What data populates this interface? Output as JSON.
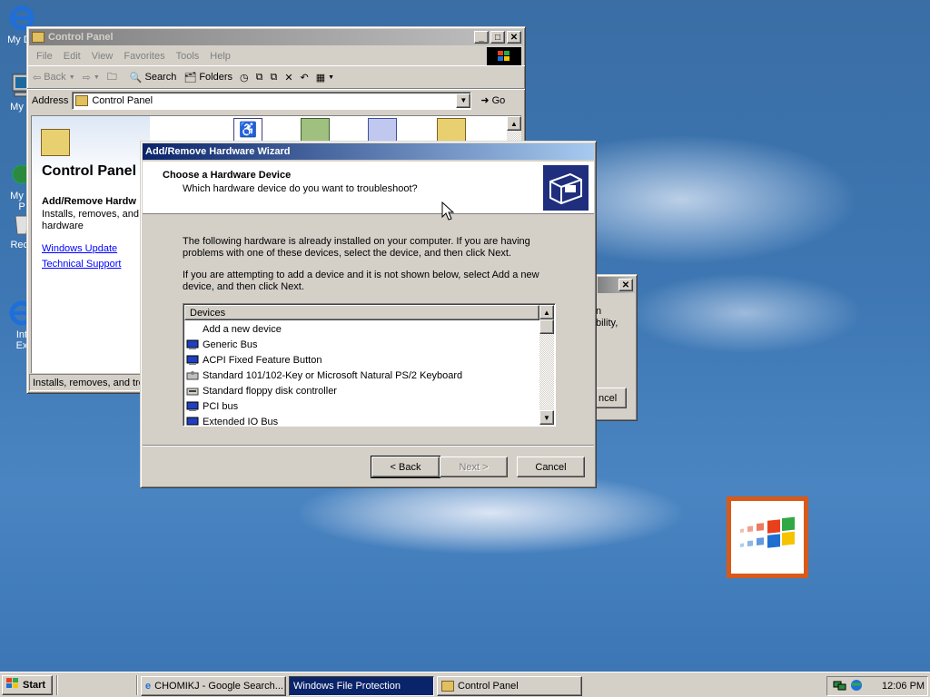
{
  "desktop": {
    "icons": [
      {
        "label": "My Do"
      },
      {
        "label": "My C"
      },
      {
        "label": "My N\nP"
      },
      {
        "label": "Recy"
      },
      {
        "label": "Int\nEx"
      }
    ]
  },
  "control_panel": {
    "title": "Control Panel",
    "menu": [
      "File",
      "Edit",
      "View",
      "Favorites",
      "Tools",
      "Help"
    ],
    "toolbar": {
      "back": "Back",
      "search": "Search",
      "folders": "Folders"
    },
    "address_label": "Address",
    "address_value": "Control Panel",
    "go_label": "Go",
    "panel_title": "Control Panel",
    "selected_title": "Add/Remove Hardw",
    "selected_desc": "Installs, removes, and hardware",
    "links": [
      "Windows Update",
      "Technical Support"
    ],
    "status_text": "Installs, removes, and tro"
  },
  "background_dialog": {
    "text_lines": [
      "n",
      "bility,"
    ],
    "button": "ncel"
  },
  "wizard": {
    "title": "Add/Remove Hardware Wizard",
    "heading": "Choose a Hardware Device",
    "subheading": "Which hardware device do you want to troubleshoot?",
    "para1": "The following hardware is already installed on your computer. If you are having problems with one of these devices, select the device, and then click Next.",
    "para2": "If you are attempting to add a device and it is not shown below, select Add a new device, and then click Next.",
    "list_header": "Devices",
    "devices": [
      {
        "name": "Add a new device",
        "icon": "none"
      },
      {
        "name": "Generic Bus",
        "icon": "computer-icon"
      },
      {
        "name": "ACPI Fixed Feature Button",
        "icon": "computer-icon"
      },
      {
        "name": "Standard 101/102-Key or Microsoft Natural PS/2 Keyboard",
        "icon": "keyboard-icon"
      },
      {
        "name": "Standard floppy disk controller",
        "icon": "floppy-controller-icon"
      },
      {
        "name": "PCI bus",
        "icon": "computer-icon"
      },
      {
        "name": "Extended IO Bus",
        "icon": "computer-icon"
      }
    ],
    "buttons": {
      "back": "< Back",
      "next": "Next >",
      "cancel": "Cancel"
    }
  },
  "taskbar": {
    "start": "Start",
    "tasks": [
      {
        "label": "CHOMIKJ - Google Search...",
        "active": false
      },
      {
        "label": "Windows File Protection",
        "active": true
      },
      {
        "label": "Control Panel",
        "active": false
      }
    ],
    "clock": "12:06 PM"
  },
  "colors": {
    "title_active": "#0a246a",
    "desktop": "#3a6ea5",
    "face": "#d4d0c8"
  }
}
